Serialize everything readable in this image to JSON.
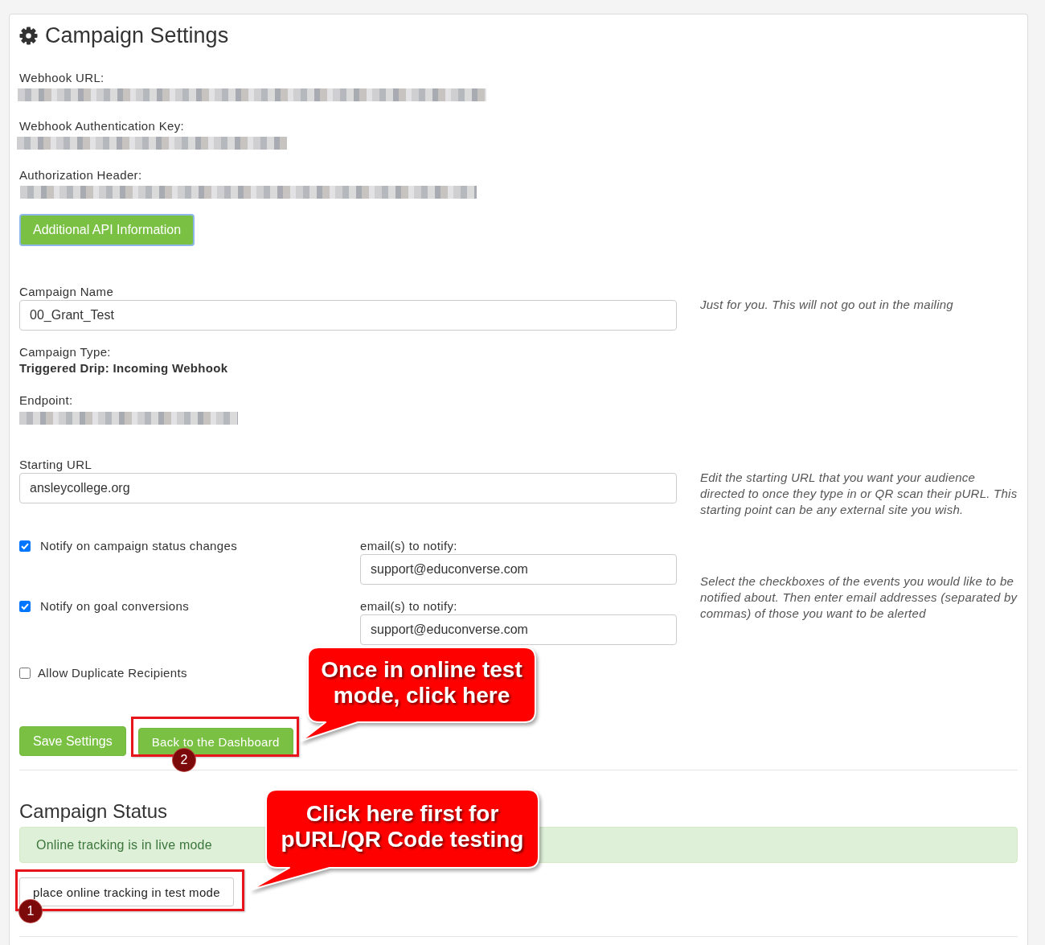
{
  "page": {
    "title": "Campaign Settings"
  },
  "api_details": [
    {
      "label": "Webhook URL:"
    },
    {
      "label": "Webhook Authentication Key:"
    },
    {
      "label": "Authorization Header:"
    }
  ],
  "api_button": {
    "label": "Additional API Information"
  },
  "campaign_name": {
    "label": "Campaign Name",
    "value": "00_Grant_Test",
    "hint": "Just for you. This will not go out in the mailing"
  },
  "campaign_type": {
    "label": "Campaign Type:",
    "value": "Triggered Drip: Incoming Webhook"
  },
  "endpoint": {
    "label": "Endpoint:"
  },
  "starting_url": {
    "label": "Starting URL",
    "value": "ansleycollege.org",
    "hint": "Edit the starting URL that you want your audience directed to once they type in or QR scan their pURL. This starting point can be any external site you wish."
  },
  "notifications": {
    "items": [
      {
        "label": "Notify on campaign status changes",
        "checked": true,
        "email_label": "email(s) to notify:",
        "email": "support@educonverse.com"
      },
      {
        "label": "Notify on goal conversions",
        "checked": true,
        "email_label": "email(s) to notify:",
        "email": "support@educonverse.com"
      }
    ],
    "hint": "Select the checkboxes of the events you would like to be notified about. Then enter email addresses (separated by commas) of those you want to be alerted"
  },
  "allow_duplicates": {
    "label": "Allow Duplicate Recipients",
    "checked": false
  },
  "actions": [
    {
      "label": "Save Settings"
    },
    {
      "label": "Back to the Dashboard"
    }
  ],
  "campaign_status": {
    "title": "Campaign Status",
    "alert": "Online tracking is in live mode",
    "button": "place online tracking in test mode"
  },
  "annotations": [
    {
      "step": "2",
      "text": "Once in online test mode, click here"
    },
    {
      "step": "1",
      "text": "Click here first for pURL/QR Code testing"
    }
  ]
}
